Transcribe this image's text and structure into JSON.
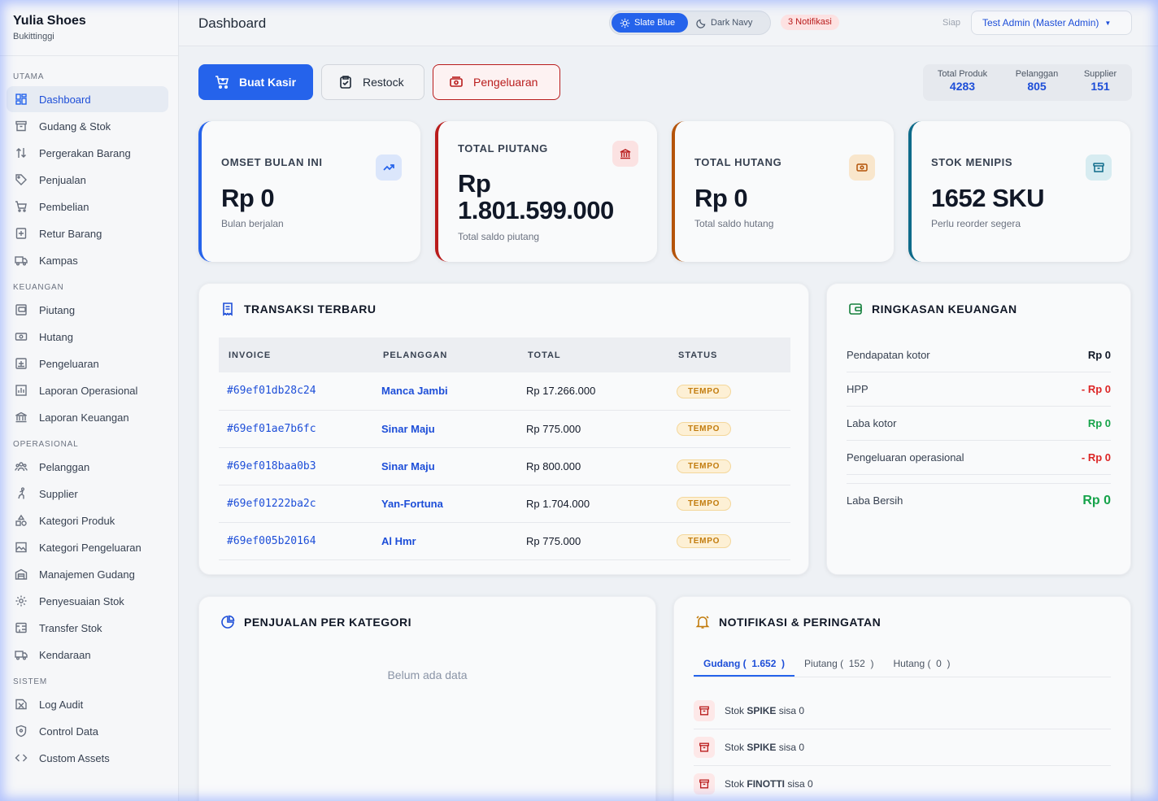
{
  "brand": {
    "name": "Yulia Shoes",
    "location": "Bukittinggi"
  },
  "sidebar": {
    "sections": [
      {
        "title": "UTAMA",
        "items": [
          {
            "label": "Dashboard",
            "icon": "dashboard-icon",
            "active": true
          },
          {
            "label": "Gudang & Stok",
            "icon": "archive-icon"
          },
          {
            "label": "Pergerakan Barang",
            "icon": "arrows-icon"
          },
          {
            "label": "Penjualan",
            "icon": "tag-icon"
          },
          {
            "label": "Pembelian",
            "icon": "cart-icon"
          },
          {
            "label": "Retur Barang",
            "icon": "return-icon"
          },
          {
            "label": "Kampas",
            "icon": "truck-icon"
          }
        ]
      },
      {
        "title": "KEUANGAN",
        "items": [
          {
            "label": "Piutang",
            "icon": "receivable-icon"
          },
          {
            "label": "Hutang",
            "icon": "money-icon"
          },
          {
            "label": "Pengeluaran",
            "icon": "expense-icon"
          },
          {
            "label": "Laporan Operasional",
            "icon": "report-chart-icon"
          },
          {
            "label": "Laporan Keuangan",
            "icon": "bank-icon"
          }
        ]
      },
      {
        "title": "OPERASIONAL",
        "items": [
          {
            "label": "Pelanggan",
            "icon": "users-icon"
          },
          {
            "label": "Supplier",
            "icon": "dolly-icon"
          },
          {
            "label": "Kategori Produk",
            "icon": "shapes-icon"
          },
          {
            "label": "Kategori Pengeluaran",
            "icon": "image-chart-icon"
          },
          {
            "label": "Manajemen Gudang",
            "icon": "warehouse-icon"
          },
          {
            "label": "Penyesuaian Stok",
            "icon": "gear-icon"
          },
          {
            "label": "Transfer Stok",
            "icon": "transfer-icon"
          },
          {
            "label": "Kendaraan",
            "icon": "truck-icon"
          }
        ]
      },
      {
        "title": "SISTEM",
        "items": [
          {
            "label": "Log Audit",
            "icon": "history-icon"
          },
          {
            "label": "Control Data",
            "icon": "shield-icon"
          },
          {
            "label": "Custom Assets",
            "icon": "code-icon"
          }
        ]
      }
    ]
  },
  "header": {
    "title": "Dashboard",
    "theme_light": "Slate Blue",
    "theme_dark": "Dark Navy",
    "notifications": "3 Notifikasi",
    "status": "Siap",
    "user": "Test Admin (Master Admin)"
  },
  "actions": {
    "kasir": "Buat Kasir",
    "restock": "Restock",
    "pengeluaran": "Pengeluaran"
  },
  "totals": [
    {
      "label": "Total Produk",
      "value": "4283"
    },
    {
      "label": "Pelanggan",
      "value": "805"
    },
    {
      "label": "Supplier",
      "value": "151"
    }
  ],
  "stats": [
    {
      "label": "OMSET BULAN INI",
      "value": "Rp 0",
      "sub": "Bulan berjalan",
      "color": "#2563eb"
    },
    {
      "label": "TOTAL PIUTANG",
      "value_line1": "Rp",
      "value_line2": "1.801.599.000",
      "sub": "Total saldo piutang",
      "color": "#b91c1c"
    },
    {
      "label": "TOTAL HUTANG",
      "value": "Rp 0",
      "sub": "Total saldo hutang",
      "color": "#b45309"
    },
    {
      "label": "STOK MENIPIS",
      "value": "1652 SKU",
      "sub": "Perlu reorder segera",
      "color": "#0e6b8a"
    }
  ],
  "transactions": {
    "title": "TRANSAKSI TERBARU",
    "columns": [
      "INVOICE",
      "PELANGGAN",
      "TOTAL",
      "STATUS"
    ],
    "rows": [
      {
        "invoice": "#69ef01db28c24",
        "customer": "Manca Jambi",
        "total": "Rp 17.266.000",
        "status": "TEMPO"
      },
      {
        "invoice": "#69ef01ae7b6fc",
        "customer": "Sinar Maju",
        "total": "Rp 775.000",
        "status": "TEMPO"
      },
      {
        "invoice": "#69ef018baa0b3",
        "customer": "Sinar Maju",
        "total": "Rp 800.000",
        "status": "TEMPO"
      },
      {
        "invoice": "#69ef01222ba2c",
        "customer": "Yan-Fortuna",
        "total": "Rp 1.704.000",
        "status": "TEMPO"
      },
      {
        "invoice": "#69ef005b20164",
        "customer": "Al Hmr",
        "total": "Rp 775.000",
        "status": "TEMPO"
      }
    ]
  },
  "finance": {
    "title": "RINGKASAN KEUANGAN",
    "rows": [
      {
        "label": "Pendapatan kotor",
        "value": "Rp 0",
        "color": "#111827"
      },
      {
        "label": "HPP",
        "value": "- Rp 0",
        "color": "#dc2626"
      },
      {
        "label": "Laba kotor",
        "value": "Rp 0",
        "color": "#16a34a"
      },
      {
        "label": "Pengeluaran operasional",
        "value": "- Rp 0",
        "color": "#dc2626"
      }
    ],
    "net_label": "Laba Bersih",
    "net_value": "Rp 0"
  },
  "category_sales": {
    "title": "PENJUALAN PER KATEGORI",
    "empty": "Belum ada data"
  },
  "alerts": {
    "title": "NOTIFIKASI & PERINGATAN",
    "tabs": [
      {
        "label": "Gudang (",
        "count": "1.652",
        "close": ")",
        "active": true
      },
      {
        "label": "Piutang (",
        "count": "152",
        "close": ")"
      },
      {
        "label": "Hutang (",
        "count": "0",
        "close": ")"
      }
    ],
    "items": [
      {
        "prefix": "Stok",
        "name": "SPIKE",
        "suffix": "sisa 0"
      },
      {
        "prefix": "Stok",
        "name": "SPIKE",
        "suffix": "sisa 0"
      },
      {
        "prefix": "Stok",
        "name": "FINOTTI",
        "suffix": "sisa 0"
      }
    ]
  }
}
